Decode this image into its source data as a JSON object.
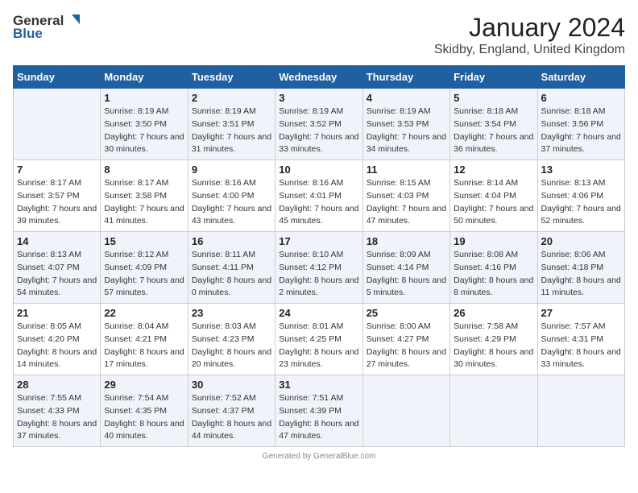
{
  "logo": {
    "general": "General",
    "blue": "Blue"
  },
  "header": {
    "month": "January 2024",
    "location": "Skidby, England, United Kingdom"
  },
  "weekdays": [
    "Sunday",
    "Monday",
    "Tuesday",
    "Wednesday",
    "Thursday",
    "Friday",
    "Saturday"
  ],
  "weeks": [
    [
      {
        "day": "",
        "sunrise": "",
        "sunset": "",
        "daylight": ""
      },
      {
        "day": "1",
        "sunrise": "Sunrise: 8:19 AM",
        "sunset": "Sunset: 3:50 PM",
        "daylight": "Daylight: 7 hours and 30 minutes."
      },
      {
        "day": "2",
        "sunrise": "Sunrise: 8:19 AM",
        "sunset": "Sunset: 3:51 PM",
        "daylight": "Daylight: 7 hours and 31 minutes."
      },
      {
        "day": "3",
        "sunrise": "Sunrise: 8:19 AM",
        "sunset": "Sunset: 3:52 PM",
        "daylight": "Daylight: 7 hours and 33 minutes."
      },
      {
        "day": "4",
        "sunrise": "Sunrise: 8:19 AM",
        "sunset": "Sunset: 3:53 PM",
        "daylight": "Daylight: 7 hours and 34 minutes."
      },
      {
        "day": "5",
        "sunrise": "Sunrise: 8:18 AM",
        "sunset": "Sunset: 3:54 PM",
        "daylight": "Daylight: 7 hours and 36 minutes."
      },
      {
        "day": "6",
        "sunrise": "Sunrise: 8:18 AM",
        "sunset": "Sunset: 3:56 PM",
        "daylight": "Daylight: 7 hours and 37 minutes."
      }
    ],
    [
      {
        "day": "7",
        "sunrise": "Sunrise: 8:17 AM",
        "sunset": "Sunset: 3:57 PM",
        "daylight": "Daylight: 7 hours and 39 minutes."
      },
      {
        "day": "8",
        "sunrise": "Sunrise: 8:17 AM",
        "sunset": "Sunset: 3:58 PM",
        "daylight": "Daylight: 7 hours and 41 minutes."
      },
      {
        "day": "9",
        "sunrise": "Sunrise: 8:16 AM",
        "sunset": "Sunset: 4:00 PM",
        "daylight": "Daylight: 7 hours and 43 minutes."
      },
      {
        "day": "10",
        "sunrise": "Sunrise: 8:16 AM",
        "sunset": "Sunset: 4:01 PM",
        "daylight": "Daylight: 7 hours and 45 minutes."
      },
      {
        "day": "11",
        "sunrise": "Sunrise: 8:15 AM",
        "sunset": "Sunset: 4:03 PM",
        "daylight": "Daylight: 7 hours and 47 minutes."
      },
      {
        "day": "12",
        "sunrise": "Sunrise: 8:14 AM",
        "sunset": "Sunset: 4:04 PM",
        "daylight": "Daylight: 7 hours and 50 minutes."
      },
      {
        "day": "13",
        "sunrise": "Sunrise: 8:13 AM",
        "sunset": "Sunset: 4:06 PM",
        "daylight": "Daylight: 7 hours and 52 minutes."
      }
    ],
    [
      {
        "day": "14",
        "sunrise": "Sunrise: 8:13 AM",
        "sunset": "Sunset: 4:07 PM",
        "daylight": "Daylight: 7 hours and 54 minutes."
      },
      {
        "day": "15",
        "sunrise": "Sunrise: 8:12 AM",
        "sunset": "Sunset: 4:09 PM",
        "daylight": "Daylight: 7 hours and 57 minutes."
      },
      {
        "day": "16",
        "sunrise": "Sunrise: 8:11 AM",
        "sunset": "Sunset: 4:11 PM",
        "daylight": "Daylight: 8 hours and 0 minutes."
      },
      {
        "day": "17",
        "sunrise": "Sunrise: 8:10 AM",
        "sunset": "Sunset: 4:12 PM",
        "daylight": "Daylight: 8 hours and 2 minutes."
      },
      {
        "day": "18",
        "sunrise": "Sunrise: 8:09 AM",
        "sunset": "Sunset: 4:14 PM",
        "daylight": "Daylight: 8 hours and 5 minutes."
      },
      {
        "day": "19",
        "sunrise": "Sunrise: 8:08 AM",
        "sunset": "Sunset: 4:16 PM",
        "daylight": "Daylight: 8 hours and 8 minutes."
      },
      {
        "day": "20",
        "sunrise": "Sunrise: 8:06 AM",
        "sunset": "Sunset: 4:18 PM",
        "daylight": "Daylight: 8 hours and 11 minutes."
      }
    ],
    [
      {
        "day": "21",
        "sunrise": "Sunrise: 8:05 AM",
        "sunset": "Sunset: 4:20 PM",
        "daylight": "Daylight: 8 hours and 14 minutes."
      },
      {
        "day": "22",
        "sunrise": "Sunrise: 8:04 AM",
        "sunset": "Sunset: 4:21 PM",
        "daylight": "Daylight: 8 hours and 17 minutes."
      },
      {
        "day": "23",
        "sunrise": "Sunrise: 8:03 AM",
        "sunset": "Sunset: 4:23 PM",
        "daylight": "Daylight: 8 hours and 20 minutes."
      },
      {
        "day": "24",
        "sunrise": "Sunrise: 8:01 AM",
        "sunset": "Sunset: 4:25 PM",
        "daylight": "Daylight: 8 hours and 23 minutes."
      },
      {
        "day": "25",
        "sunrise": "Sunrise: 8:00 AM",
        "sunset": "Sunset: 4:27 PM",
        "daylight": "Daylight: 8 hours and 27 minutes."
      },
      {
        "day": "26",
        "sunrise": "Sunrise: 7:58 AM",
        "sunset": "Sunset: 4:29 PM",
        "daylight": "Daylight: 8 hours and 30 minutes."
      },
      {
        "day": "27",
        "sunrise": "Sunrise: 7:57 AM",
        "sunset": "Sunset: 4:31 PM",
        "daylight": "Daylight: 8 hours and 33 minutes."
      }
    ],
    [
      {
        "day": "28",
        "sunrise": "Sunrise: 7:55 AM",
        "sunset": "Sunset: 4:33 PM",
        "daylight": "Daylight: 8 hours and 37 minutes."
      },
      {
        "day": "29",
        "sunrise": "Sunrise: 7:54 AM",
        "sunset": "Sunset: 4:35 PM",
        "daylight": "Daylight: 8 hours and 40 minutes."
      },
      {
        "day": "30",
        "sunrise": "Sunrise: 7:52 AM",
        "sunset": "Sunset: 4:37 PM",
        "daylight": "Daylight: 8 hours and 44 minutes."
      },
      {
        "day": "31",
        "sunrise": "Sunrise: 7:51 AM",
        "sunset": "Sunset: 4:39 PM",
        "daylight": "Daylight: 8 hours and 47 minutes."
      },
      {
        "day": "",
        "sunrise": "",
        "sunset": "",
        "daylight": ""
      },
      {
        "day": "",
        "sunrise": "",
        "sunset": "",
        "daylight": ""
      },
      {
        "day": "",
        "sunrise": "",
        "sunset": "",
        "daylight": ""
      }
    ]
  ]
}
